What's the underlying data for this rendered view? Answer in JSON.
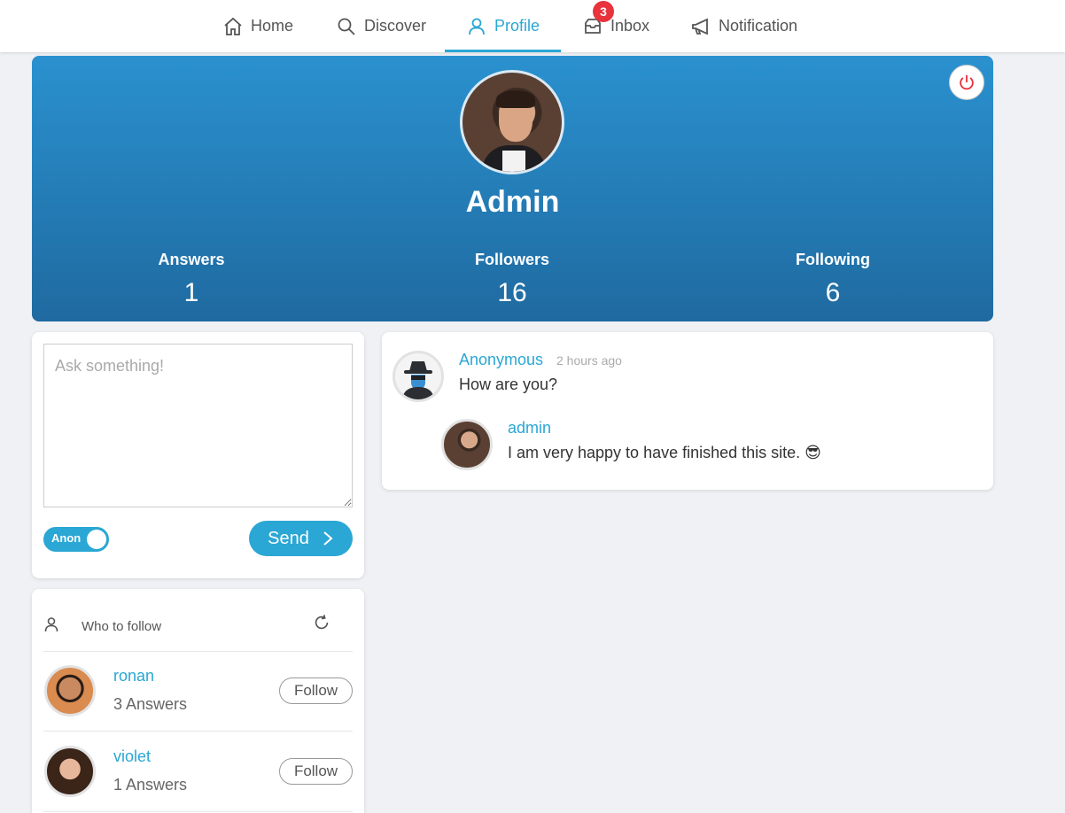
{
  "nav": {
    "home": "Home",
    "discover": "Discover",
    "profile": "Profile",
    "inbox": "Inbox",
    "inbox_badge": "3",
    "notification": "Notification"
  },
  "profile": {
    "name": "Admin",
    "stats": {
      "answers_label": "Answers",
      "answers_value": "1",
      "followers_label": "Followers",
      "followers_value": "16",
      "following_label": "Following",
      "following_value": "6"
    }
  },
  "ask": {
    "placeholder": "Ask something!",
    "anon_label": "Anon",
    "anon_on": true,
    "send_label": "Send"
  },
  "who_to_follow": {
    "title": "Who to follow",
    "users": [
      {
        "name": "ronan",
        "answers": "3 Answers",
        "button": "Follow"
      },
      {
        "name": "violet",
        "answers": "1 Answers",
        "button": "Follow"
      }
    ]
  },
  "question": {
    "author": "Anonymous",
    "time": "2 hours ago",
    "text": "How are you?",
    "answer": {
      "author": "admin",
      "text": "I am very happy to have finished this site. 😎"
    }
  },
  "colors": {
    "accent": "#2aa7d4",
    "header_top": "#2a91cf",
    "header_bottom": "#1f6aa0",
    "badge": "#e8323c"
  }
}
